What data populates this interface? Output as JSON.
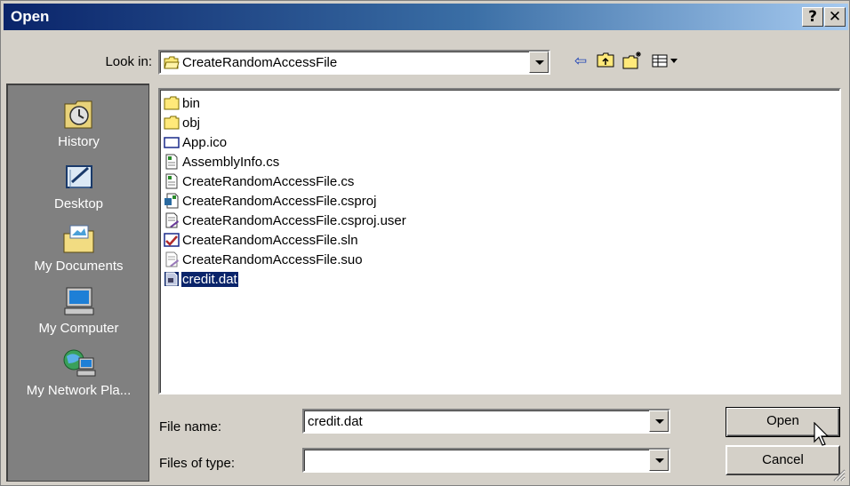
{
  "window": {
    "title": "Open",
    "help_label": "?",
    "close_label": "✕"
  },
  "toolbar": {
    "look_in_label": "Look in:",
    "look_in_value": "CreateRandomAccessFile",
    "icons": [
      "back-arrow-icon",
      "up-one-level-icon",
      "new-folder-icon",
      "views-menu-icon"
    ]
  },
  "places_bar": [
    {
      "label": "History",
      "icon": "history-icon"
    },
    {
      "label": "Desktop",
      "icon": "desktop-icon"
    },
    {
      "label": "My Documents",
      "icon": "my-documents-icon"
    },
    {
      "label": "My Computer",
      "icon": "my-computer-icon"
    },
    {
      "label": "My Network Pla...",
      "icon": "network-places-icon"
    }
  ],
  "files": [
    {
      "name": "bin",
      "icon": "folder-icon"
    },
    {
      "name": "obj",
      "icon": "folder-icon"
    },
    {
      "name": "App.ico",
      "icon": "ico-file-icon"
    },
    {
      "name": "AssemblyInfo.cs",
      "icon": "cs-file-icon"
    },
    {
      "name": "CreateRandomAccessFile.cs",
      "icon": "cs-file-icon"
    },
    {
      "name": "CreateRandomAccessFile.csproj",
      "icon": "csproj-file-icon"
    },
    {
      "name": "CreateRandomAccessFile.csproj.user",
      "icon": "csproj-user-file-icon"
    },
    {
      "name": "CreateRandomAccessFile.sln",
      "icon": "sln-file-icon"
    },
    {
      "name": "CreateRandomAccessFile.suo",
      "icon": "suo-file-icon"
    },
    {
      "name": "credit.dat",
      "icon": "dat-file-icon",
      "selected": true
    }
  ],
  "footer": {
    "file_name_label": "File name:",
    "file_name_value": "credit.dat",
    "files_of_type_label": "Files of type:",
    "files_of_type_value": "",
    "open_label": "Open",
    "cancel_label": "Cancel"
  },
  "colors": {
    "title_gradient_start": "#0a246a",
    "title_gradient_end": "#a6caf0",
    "face": "#d4d0c8",
    "selection": "#0a246a",
    "places_bar": "#808080"
  }
}
